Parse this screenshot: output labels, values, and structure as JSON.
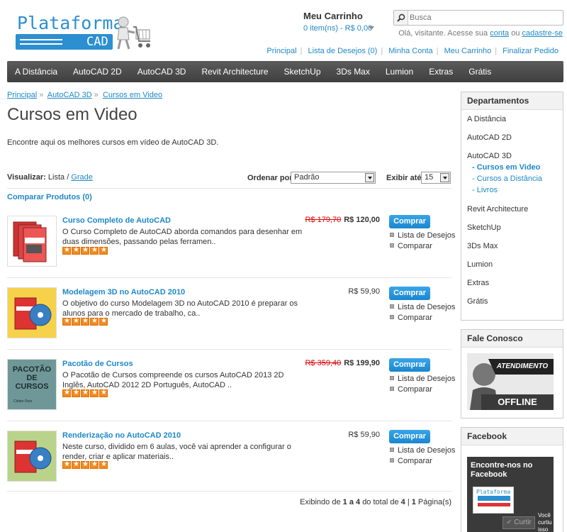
{
  "brand": {
    "name_top": "Plataforma",
    "name_bottom": "CAD"
  },
  "cart": {
    "title": "Meu Carrinho",
    "summary": "0 item(ns) - R$ 0,00"
  },
  "search": {
    "placeholder": "Busca"
  },
  "welcome": {
    "prefix": "Olá, visitante. Acesse sua",
    "account_link": "conta",
    "middle": "ou",
    "register_link": "cadastre-se"
  },
  "top_links": [
    "Principal",
    "Lista de Desejos (0)",
    "Minha Conta",
    "Meu Carrinho",
    "Finalizar Pedido"
  ],
  "nav": [
    "A Distância",
    "AutoCAD 2D",
    "AutoCAD 3D",
    "Revit Architecture",
    "SketchUp",
    "3Ds Max",
    "Lumion",
    "Extras",
    "Grátis"
  ],
  "breadcrumb": [
    "Principal",
    "AutoCAD 3D",
    "Cursos em Video"
  ],
  "breadcrumb_sep": "»",
  "page_title": "Cursos em Video",
  "intro": "Encontre aqui os melhores cursos em vídeo de AutoCAD 3D.",
  "toolbar": {
    "view_label": "Visualizar:",
    "view_list": "Lista",
    "view_sep": "/",
    "view_grid": "Grade",
    "order_label": "Ordenar por:",
    "order_value": "Padrão",
    "show_label": "Exibir até:",
    "show_value": "15"
  },
  "compare_link": "Comparar Produtos (0)",
  "products": [
    {
      "name": "Curso Completo de AutoCAD",
      "desc": "O Curso Completo de AutoCAD aborda comandos para desenhar em duas dimensões, passando pelas ferramen..",
      "old_price": "R$ 179,70",
      "price": "R$ 120,00",
      "rating": 5
    },
    {
      "name": "Modelagem 3D no AutoCAD 2010",
      "desc": "O objetivo do curso Modelagem 3D no AutoCAD 2010 é preparar os alunos para o mercado de trabalho, ca..",
      "old_price": "",
      "price": "R$ 59,90",
      "rating": 5
    },
    {
      "name": "Pacotão de Cursos",
      "desc": "O Pacotão de Cursos compreende os cursos AutoCAD 2013 2D Inglês, AutoCAD 2012 2D Português, AutoCAD ..",
      "old_price": "R$ 359,40",
      "price": "R$ 199,90",
      "rating": 5,
      "thumb_text1": "PACOTÃO",
      "thumb_text2": "DE",
      "thumb_text3": "CURSOS",
      "thumb_author": "Cleber Reis"
    },
    {
      "name": "Renderização no AutoCAD 2010",
      "desc": "Neste curso, dividido em 6 aulas, você vai aprender a configurar o render, criar e aplicar materiais..",
      "old_price": "",
      "price": "R$ 59,90",
      "rating": 5
    }
  ],
  "product_actions": {
    "buy": "Comprar",
    "wishlist": "Lista de Desejos",
    "compare": "Comparar"
  },
  "pager": {
    "prefix": "Exibindo de",
    "from_to": "1 a 4",
    "mid": "do total de",
    "total": "4",
    "sep": "|",
    "pages": "1",
    "suffix": "Página(s)"
  },
  "sidebar": {
    "departments_title": "Departamentos",
    "departments": [
      "A Distância",
      "AutoCAD 2D",
      "AutoCAD 3D",
      "Revit Architecture",
      "SketchUp",
      "3Ds Max",
      "Lumion",
      "Extras",
      "Grátis"
    ],
    "subdepartments": [
      "- Cursos em Video",
      "- Cursos a Distância",
      "- Livros"
    ],
    "contact_title": "Fale Conosco",
    "contact_banner_top": "ATENDIMENTO",
    "contact_banner_bottom": "OFFLINE",
    "facebook_title": "Facebook",
    "fb_widget_title": "Encontre-nos no Facebook",
    "fb_like": "Curtir",
    "fb_side_text": "Você curtiu isso"
  },
  "colors": {
    "accent": "#1e88c7",
    "nav_bg": "#4a4a4a",
    "star": "#f08a1c",
    "old_price": "#dd0000"
  }
}
